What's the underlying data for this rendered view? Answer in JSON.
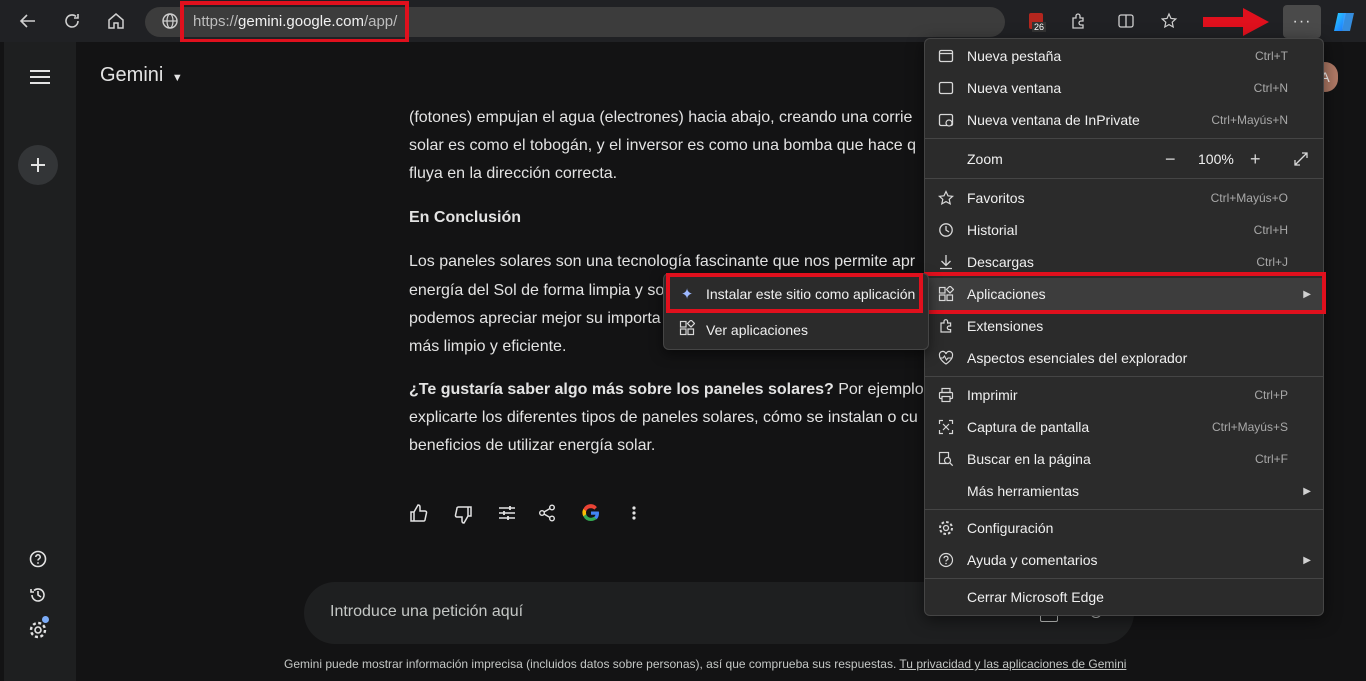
{
  "browser": {
    "url_prefix": "https://",
    "url_domain": "gemini.google.com",
    "url_path": "/app/",
    "badge_count": "26",
    "more_label": "···"
  },
  "app": {
    "title": "Gemini",
    "avatar_letter": "A"
  },
  "content": {
    "line1": "(fotones) empujan el agua (electrones) hacia abajo, creando una corrie",
    "line2": "solar es como el tobogán, y el inversor es como una bomba que hace q",
    "line3": "fluya en la dirección correcta.",
    "heading": "En Conclusión",
    "p1": "Los paneles solares son una tecnología fascinante que nos permite apr",
    "p2": "energía del Sol de forma limpia y so",
    "p3": "podemos apreciar mejor su importa",
    "p4": "más limpio y eficiente.",
    "q_bold": "¿Te gustaría saber algo más sobre los paneles solares?",
    "q_rest": " Por ejemplo",
    "q2": "explicarte los diferentes tipos de paneles solares, cómo se instalan o cu",
    "q3": "beneficios de utilizar energía solar."
  },
  "prompt": {
    "placeholder": "Introduce una petición aquí"
  },
  "footer": {
    "text": "Gemini puede mostrar información imprecisa (incluidos datos sobre personas), así que comprueba sus respuestas. ",
    "link": "Tu privacidad y las aplicaciones de Gemini"
  },
  "menu": {
    "new_tab": "Nueva pestaña",
    "new_tab_sc": "Ctrl+T",
    "new_window": "Nueva ventana",
    "new_window_sc": "Ctrl+N",
    "inprivate": "Nueva ventana de InPrivate",
    "inprivate_sc": "Ctrl+Mayús+N",
    "zoom": "Zoom",
    "zoom_value": "100%",
    "favorites": "Favoritos",
    "favorites_sc": "Ctrl+Mayús+O",
    "history": "Historial",
    "history_sc": "Ctrl+H",
    "downloads": "Descargas",
    "downloads_sc": "Ctrl+J",
    "apps": "Aplicaciones",
    "extensions": "Extensiones",
    "essentials": "Aspectos esenciales del explorador",
    "print": "Imprimir",
    "print_sc": "Ctrl+P",
    "screenshot": "Captura de pantalla",
    "screenshot_sc": "Ctrl+Mayús+S",
    "find": "Buscar en la página",
    "find_sc": "Ctrl+F",
    "more_tools": "Más herramientas",
    "settings": "Configuración",
    "help": "Ayuda y comentarios",
    "close": "Cerrar Microsoft Edge"
  },
  "submenu": {
    "install": "Instalar este sitio como aplicación",
    "view_apps": "Ver aplicaciones"
  }
}
